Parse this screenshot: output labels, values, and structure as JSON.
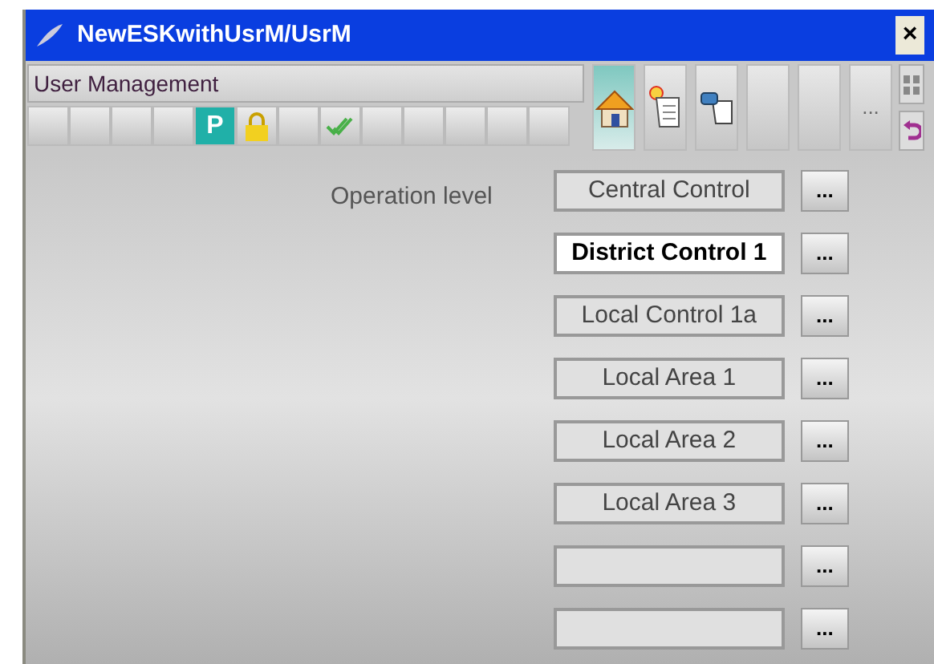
{
  "window": {
    "title": "NewESKwithUsrM/UsrM",
    "close": "×"
  },
  "header": {
    "title": "User Management"
  },
  "tool_buttons": [
    {
      "kind": "blank"
    },
    {
      "kind": "blank"
    },
    {
      "kind": "blank"
    },
    {
      "kind": "blank"
    },
    {
      "kind": "letter",
      "text": "P"
    },
    {
      "kind": "lock"
    },
    {
      "kind": "blank"
    },
    {
      "kind": "check"
    },
    {
      "kind": "blank"
    },
    {
      "kind": "blank"
    },
    {
      "kind": "blank"
    },
    {
      "kind": "blank"
    },
    {
      "kind": "blank"
    }
  ],
  "nav_buttons": [
    {
      "kind": "home",
      "selected": true
    },
    {
      "kind": "scroll",
      "selected": false
    },
    {
      "kind": "device",
      "selected": false
    },
    {
      "kind": "blank",
      "selected": false
    },
    {
      "kind": "blank",
      "selected": false
    },
    {
      "kind": "text",
      "text": "...",
      "selected": false
    }
  ],
  "side_buttons": [
    {
      "kind": "grid"
    },
    {
      "kind": "undo"
    }
  ],
  "operation_label": "Operation level",
  "levels": [
    {
      "text": "Central Control",
      "selected": false,
      "button": "..."
    },
    {
      "text": "District Control 1",
      "selected": true,
      "button": "..."
    },
    {
      "text": "Local Control 1a",
      "selected": false,
      "button": "..."
    },
    {
      "text": "Local Area 1",
      "selected": false,
      "button": "..."
    },
    {
      "text": "Local Area 2",
      "selected": false,
      "button": "..."
    },
    {
      "text": "Local Area 3",
      "selected": false,
      "button": "..."
    },
    {
      "selected": false,
      "button": "..."
    },
    {
      "selected": false,
      "button": "..."
    }
  ]
}
